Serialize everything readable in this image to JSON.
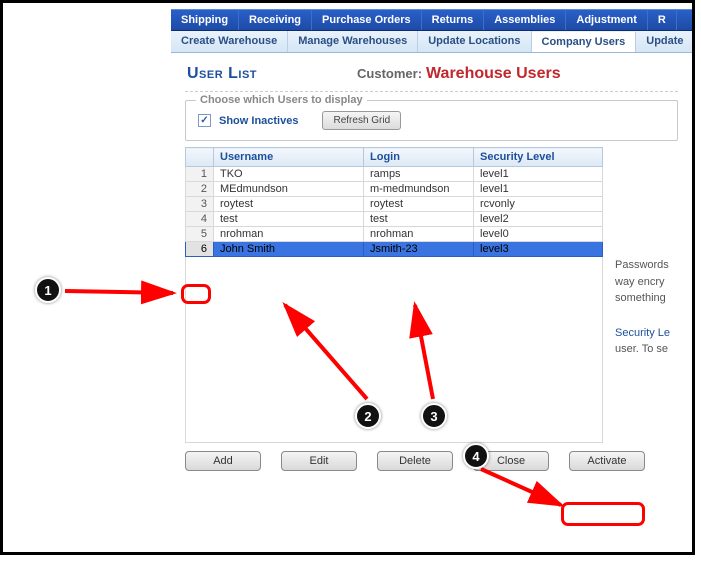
{
  "nav1": [
    "Shipping",
    "Receiving",
    "Purchase Orders",
    "Returns",
    "Assemblies",
    "Adjustment",
    "R"
  ],
  "nav2": {
    "items": [
      "Create Warehouse",
      "Manage Warehouses",
      "Update Locations",
      "Company Users",
      "Update"
    ],
    "active_index": 3
  },
  "page": {
    "title": "User List",
    "customer_label": "Customer:",
    "customer_name": "Warehouse Users"
  },
  "filter": {
    "legend": "Choose which Users to display",
    "show_inactives_label": "Show Inactives",
    "show_inactives_checked": true,
    "refresh_label": "Refresh Grid"
  },
  "grid": {
    "headers": [
      "",
      "Username",
      "Login",
      "Security Level"
    ],
    "rows": [
      {
        "n": "1",
        "username": "TKO",
        "login": "ramps",
        "level": "level1",
        "selected": false
      },
      {
        "n": "2",
        "username": "MEdmundson",
        "login": "m-medmundson",
        "level": "level1",
        "selected": false
      },
      {
        "n": "3",
        "username": "roytest",
        "login": "roytest",
        "level": "rcvonly",
        "selected": false
      },
      {
        "n": "4",
        "username": "test",
        "login": "test",
        "level": "level2",
        "selected": false
      },
      {
        "n": "5",
        "username": "nrohman",
        "login": "nrohman",
        "level": "level0",
        "selected": false
      },
      {
        "n": "6",
        "username": "John Smith",
        "login": "Jsmith-23",
        "level": "level3",
        "selected": true
      }
    ]
  },
  "side": {
    "line1": "Passwords",
    "line2": "way encry",
    "line3": "something",
    "line4": "Security Le",
    "line5": "user. To se"
  },
  "buttons": {
    "add": "Add",
    "edit": "Edit",
    "delete": "Delete",
    "close": "Close",
    "activate": "Activate"
  },
  "annotations": {
    "b1": "1",
    "b2": "2",
    "b3": "3",
    "b4": "4"
  }
}
